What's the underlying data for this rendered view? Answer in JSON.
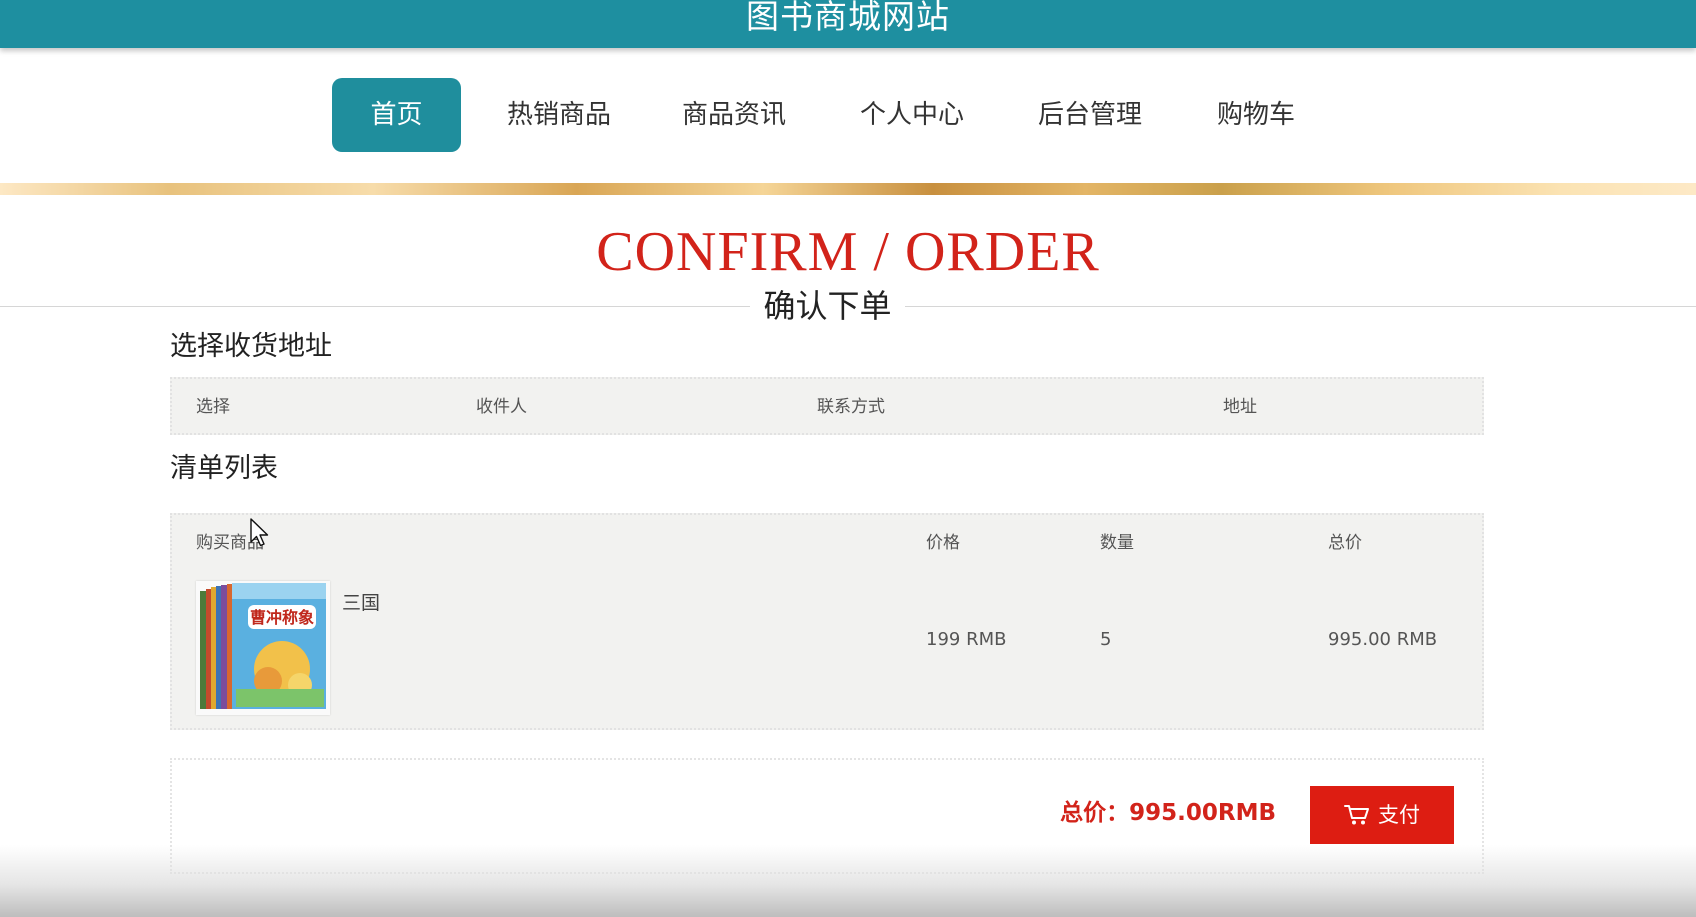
{
  "header": {
    "site_title": "图书商城网站"
  },
  "nav": {
    "items": [
      {
        "label": "首页",
        "active": true
      },
      {
        "label": "热销商品"
      },
      {
        "label": "商品资讯"
      },
      {
        "label": "个人中心"
      },
      {
        "label": "后台管理"
      },
      {
        "label": "购物车"
      }
    ]
  },
  "page_heading": {
    "en": "CONFIRM / ORDER",
    "cn": "确认下单"
  },
  "address_section": {
    "title": "选择收货地址",
    "columns": [
      "选择",
      "收件人",
      "联系方式",
      "地址"
    ]
  },
  "list_section": {
    "title": "清单列表",
    "columns": [
      "购买商品",
      "价格",
      "数量",
      "总价"
    ],
    "rows": [
      {
        "product_name": "三国",
        "cover_text": "曹冲称象",
        "price": "199 RMB",
        "quantity": "5",
        "total": "995.00 RMB"
      }
    ]
  },
  "checkout": {
    "total_label": "总价：995.00RMB",
    "pay_label": "支付",
    "pay_icon": "cart-icon"
  },
  "colors": {
    "header_bg": "#1e8fa0",
    "nav_active_bg": "#1f8e9d",
    "accent_red": "#d2231a",
    "pay_button_bg": "#dd1d12",
    "panel_bg": "#f2f2f0"
  }
}
